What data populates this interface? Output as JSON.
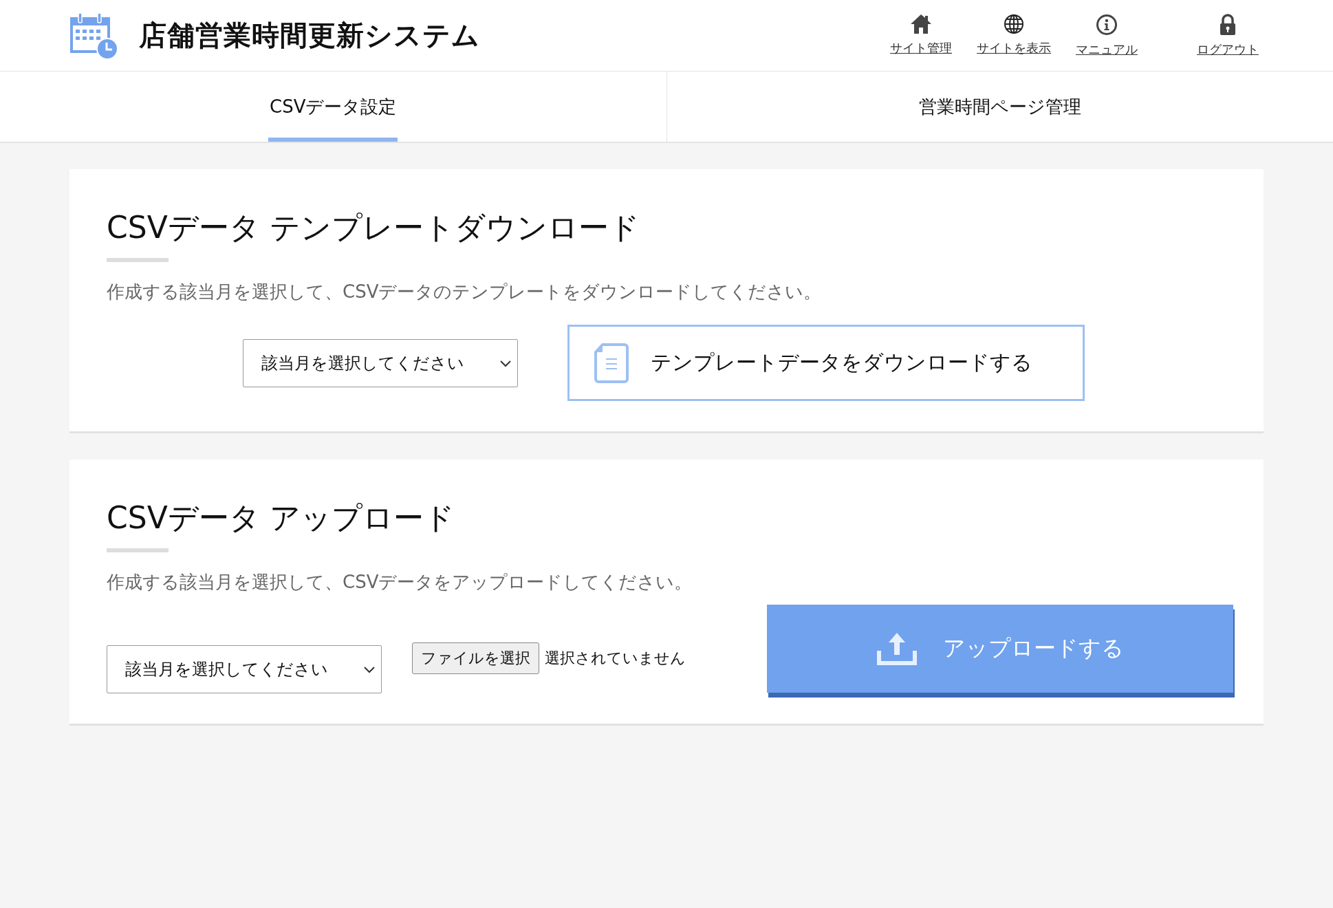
{
  "header": {
    "title": "店舗営業時間更新システム",
    "nav": [
      {
        "kind": "home",
        "label": "サイト管理"
      },
      {
        "kind": "globe",
        "label": "サイトを表示"
      },
      {
        "kind": "info",
        "label": "マニュアル"
      },
      {
        "kind": "lock",
        "label": "ログアウト"
      }
    ]
  },
  "tabs": [
    {
      "label": "CSVデータ設定",
      "selected": true
    },
    {
      "label": "営業時間ページ管理",
      "selected": false
    }
  ],
  "download": {
    "heading": "CSVデータ テンプレートダウンロード",
    "description": "作成する該当月を選択して、CSVデータのテンプレートをダウンロードしてください。",
    "select": "該当月を選択してください",
    "button": "テンプレートデータをダウンロードする"
  },
  "upload": {
    "heading": "CSVデータ アップロード",
    "description": "作成する該当月を選択して、CSVデータをアップロードしてください。",
    "select": "該当月を選択してください",
    "file_button": "ファイルを選択",
    "file_status": "選択されていません",
    "button": "アップロードする"
  }
}
